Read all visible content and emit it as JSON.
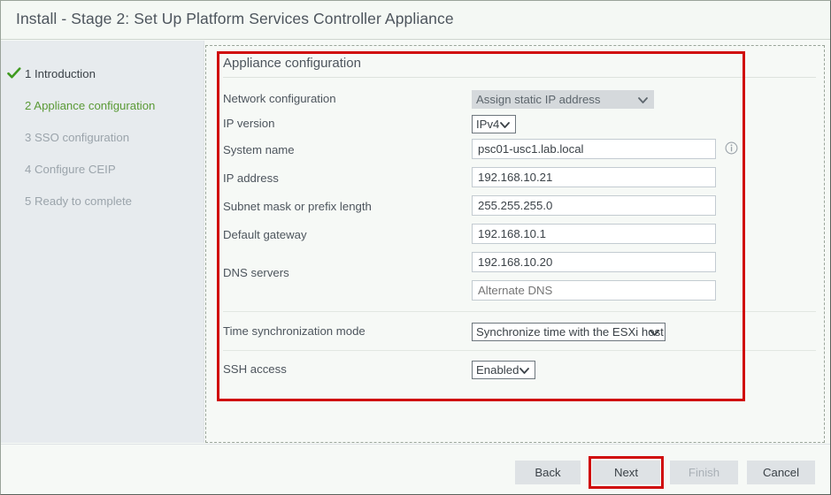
{
  "window": {
    "title": "Install - Stage 2: Set Up Platform Services Controller Appliance"
  },
  "sidebar": {
    "items": [
      {
        "label": "1 Introduction",
        "state": "done",
        "icon": "check-icon"
      },
      {
        "label": "2 Appliance configuration",
        "state": "active"
      },
      {
        "label": "3 SSO configuration",
        "state": "todo"
      },
      {
        "label": "4 Configure CEIP",
        "state": "todo"
      },
      {
        "label": "5 Ready to complete",
        "state": "todo"
      }
    ]
  },
  "form": {
    "section_title": "Appliance configuration",
    "labels": {
      "network_configuration": "Network configuration",
      "ip_version": "IP version",
      "system_name": "System name",
      "ip_address": "IP address",
      "subnet_mask": "Subnet mask or prefix length",
      "default_gateway": "Default gateway",
      "dns_servers": "DNS servers",
      "time_sync_mode": "Time synchronization mode",
      "ssh_access": "SSH access"
    },
    "values": {
      "network_configuration": "Assign static IP address",
      "ip_version": "IPv4",
      "system_name": "psc01-usc1.lab.local",
      "ip_address": "192.168.10.21",
      "subnet_mask": "255.255.255.0",
      "default_gateway": "192.168.10.1",
      "dns_primary": "192.168.10.20",
      "dns_alternate": "",
      "time_sync_mode": "Synchronize time with the ESXi host",
      "ssh_access": "Enabled"
    },
    "placeholders": {
      "dns_alternate": "Alternate DNS"
    },
    "icons": {
      "system_name_info": "info-icon"
    }
  },
  "footer": {
    "buttons": [
      {
        "label": "Back",
        "state": "enabled"
      },
      {
        "label": "Next",
        "state": "highlighted"
      },
      {
        "label": "Finish",
        "state": "disabled"
      },
      {
        "label": "Cancel",
        "state": "enabled"
      }
    ]
  },
  "colors": {
    "annotation": "#d00b0b",
    "active_step": "#5a9a36",
    "check": "#3f9a20"
  }
}
